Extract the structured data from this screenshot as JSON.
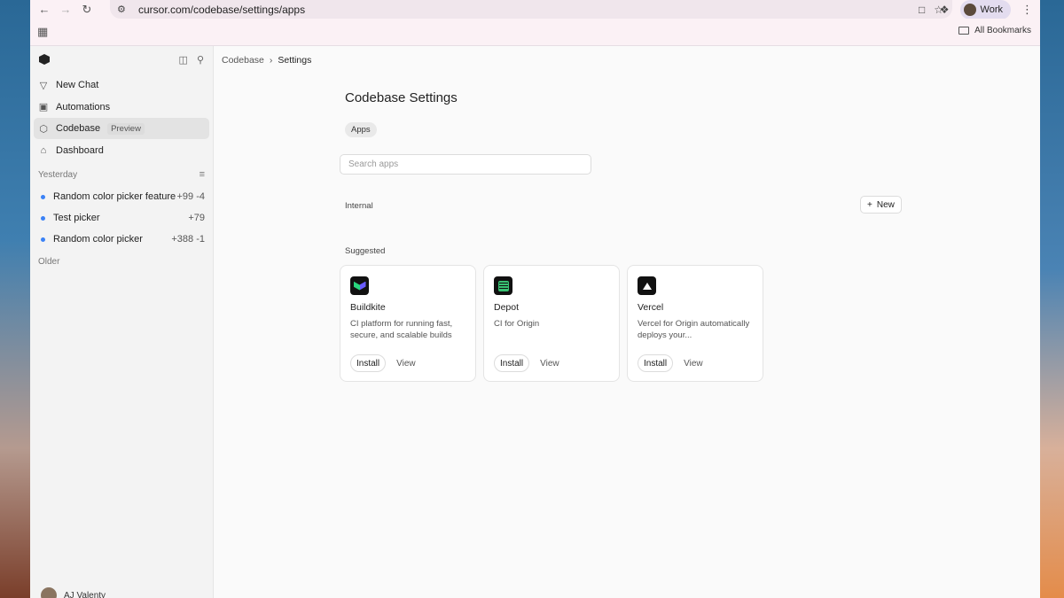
{
  "browser": {
    "url": "cursor.com/codebase/settings/apps",
    "profile_label": "Work",
    "all_bookmarks_label": "All Bookmarks"
  },
  "sidebar": {
    "items": [
      {
        "label": "New Chat",
        "icon": "branch-icon"
      },
      {
        "label": "Automations",
        "icon": "robot-icon"
      },
      {
        "label": "Codebase",
        "icon": "cube-icon",
        "badge": "Preview",
        "active": true
      },
      {
        "label": "Dashboard",
        "icon": "home-icon"
      }
    ],
    "sections": {
      "yesterday": "Yesterday",
      "older": "Older"
    },
    "chats": [
      {
        "title": "Random color picker feature",
        "stats": "+99 -4"
      },
      {
        "title": "Test picker",
        "stats": "+79"
      },
      {
        "title": "Random color picker",
        "stats": "+388 -1"
      }
    ],
    "user_name": "AJ Valenty"
  },
  "main": {
    "breadcrumb": {
      "parent": "Codebase",
      "current": "Settings"
    },
    "title": "Codebase Settings",
    "tab": "Apps",
    "search_placeholder": "Search apps",
    "internal_label": "Internal",
    "new_button": "New",
    "suggested_label": "Suggested",
    "apps": [
      {
        "name": "Buildkite",
        "desc": "CI platform for running fast, secure, and scalable builds",
        "install": "Install",
        "view": "View"
      },
      {
        "name": "Depot",
        "desc": "CI for Origin",
        "install": "Install",
        "view": "View"
      },
      {
        "name": "Vercel",
        "desc": "Vercel for Origin automatically deploys your...",
        "install": "Install",
        "view": "View"
      }
    ]
  }
}
